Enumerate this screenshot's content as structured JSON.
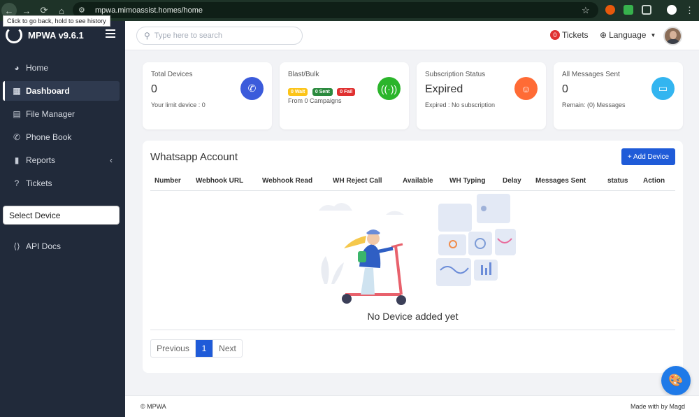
{
  "browser": {
    "url": "mpwa.mimoassist.homes/home",
    "tooltip": "Click to go back, hold to see history"
  },
  "sidebar": {
    "brand": "MPWA v9.6.1",
    "items": [
      {
        "label": "Home",
        "icon": "palette-icon"
      },
      {
        "label": "Dashboard",
        "icon": "grid-icon"
      },
      {
        "label": "File Manager",
        "icon": "file-icon"
      },
      {
        "label": "Phone Book",
        "icon": "phone-icon"
      },
      {
        "label": "Reports",
        "icon": "bookmark-icon"
      },
      {
        "label": "Tickets",
        "icon": "question-icon"
      }
    ],
    "select_device": "Select Device",
    "api_docs": "API Docs"
  },
  "topbar": {
    "search_placeholder": "Type here to search",
    "tickets_count": "0",
    "tickets_label": "Tickets",
    "language_label": "Language"
  },
  "cards": [
    {
      "title": "Total Devices",
      "value": "0",
      "sub": "Your limit device : 0",
      "icon": "whatsapp-icon",
      "color": "#3b5bdb"
    },
    {
      "title": "Blast/Bulk",
      "pills": [
        "0 Wait",
        "0 Sent",
        "0 Fail"
      ],
      "sub": "From 0 Campaigns",
      "icon": "broadcast-icon",
      "color": "#2bb52b"
    },
    {
      "title": "Subscription Status",
      "value": "Expired",
      "sub": "Expired : No subscription",
      "icon": "smile-icon",
      "color": "#ff6b35"
    },
    {
      "title": "All Messages Sent",
      "value": "0",
      "sub": "Remain: (0) Messages",
      "icon": "message-icon",
      "color": "#33b5f0"
    }
  ],
  "panel": {
    "title": "Whatsapp Account",
    "add_button": "+ Add Device",
    "columns": [
      "Number",
      "Webhook URL",
      "Webhook Read",
      "WH Reject Call",
      "Available",
      "WH Typing",
      "Delay",
      "Messages Sent",
      "status",
      "Action"
    ],
    "empty_text": "No Device added yet",
    "pagination": {
      "previous": "Previous",
      "current": "1",
      "next": "Next"
    }
  },
  "footer": {
    "left": "© MPWA",
    "right": "Made with by Magd"
  }
}
